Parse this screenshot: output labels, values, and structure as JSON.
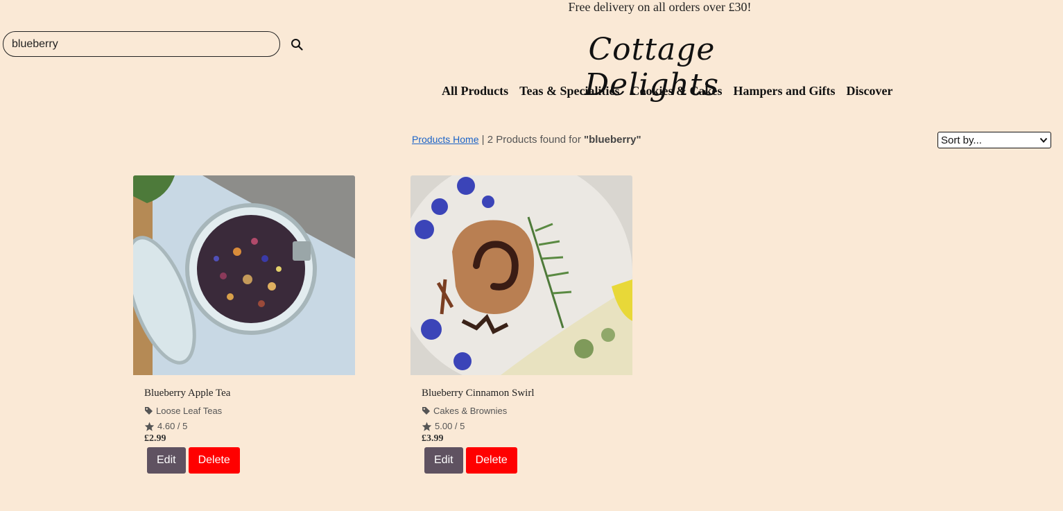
{
  "banner": "Free delivery on all orders over £30!",
  "search": {
    "value": "blueberry",
    "icon": "search-icon"
  },
  "logo": "Cottage Delights",
  "nav": [
    "All Products",
    "Teas & Specialities",
    "Cookies & Cakes",
    "Hampers and Gifts",
    "Discover"
  ],
  "results": {
    "home_link": "Products Home",
    "separator": "|",
    "count_text": "2 Products found for",
    "query": "\"blueberry\""
  },
  "sort": {
    "selected": "Sort by..."
  },
  "products": [
    {
      "name": "Blueberry Apple Tea",
      "category": "Loose Leaf Teas",
      "rating": "4.60 / 5",
      "price": "£2.99",
      "edit_label": "Edit",
      "delete_label": "Delete"
    },
    {
      "name": "Blueberry Cinnamon Swirl",
      "category": "Cakes & Brownies",
      "rating": "5.00 / 5",
      "price": "£3.99",
      "edit_label": "Edit",
      "delete_label": "Delete"
    }
  ],
  "colors": {
    "background": "#fae9d6",
    "edit_button": "#5f5261",
    "delete_button": "#ff0000",
    "link": "#1a62c7"
  }
}
